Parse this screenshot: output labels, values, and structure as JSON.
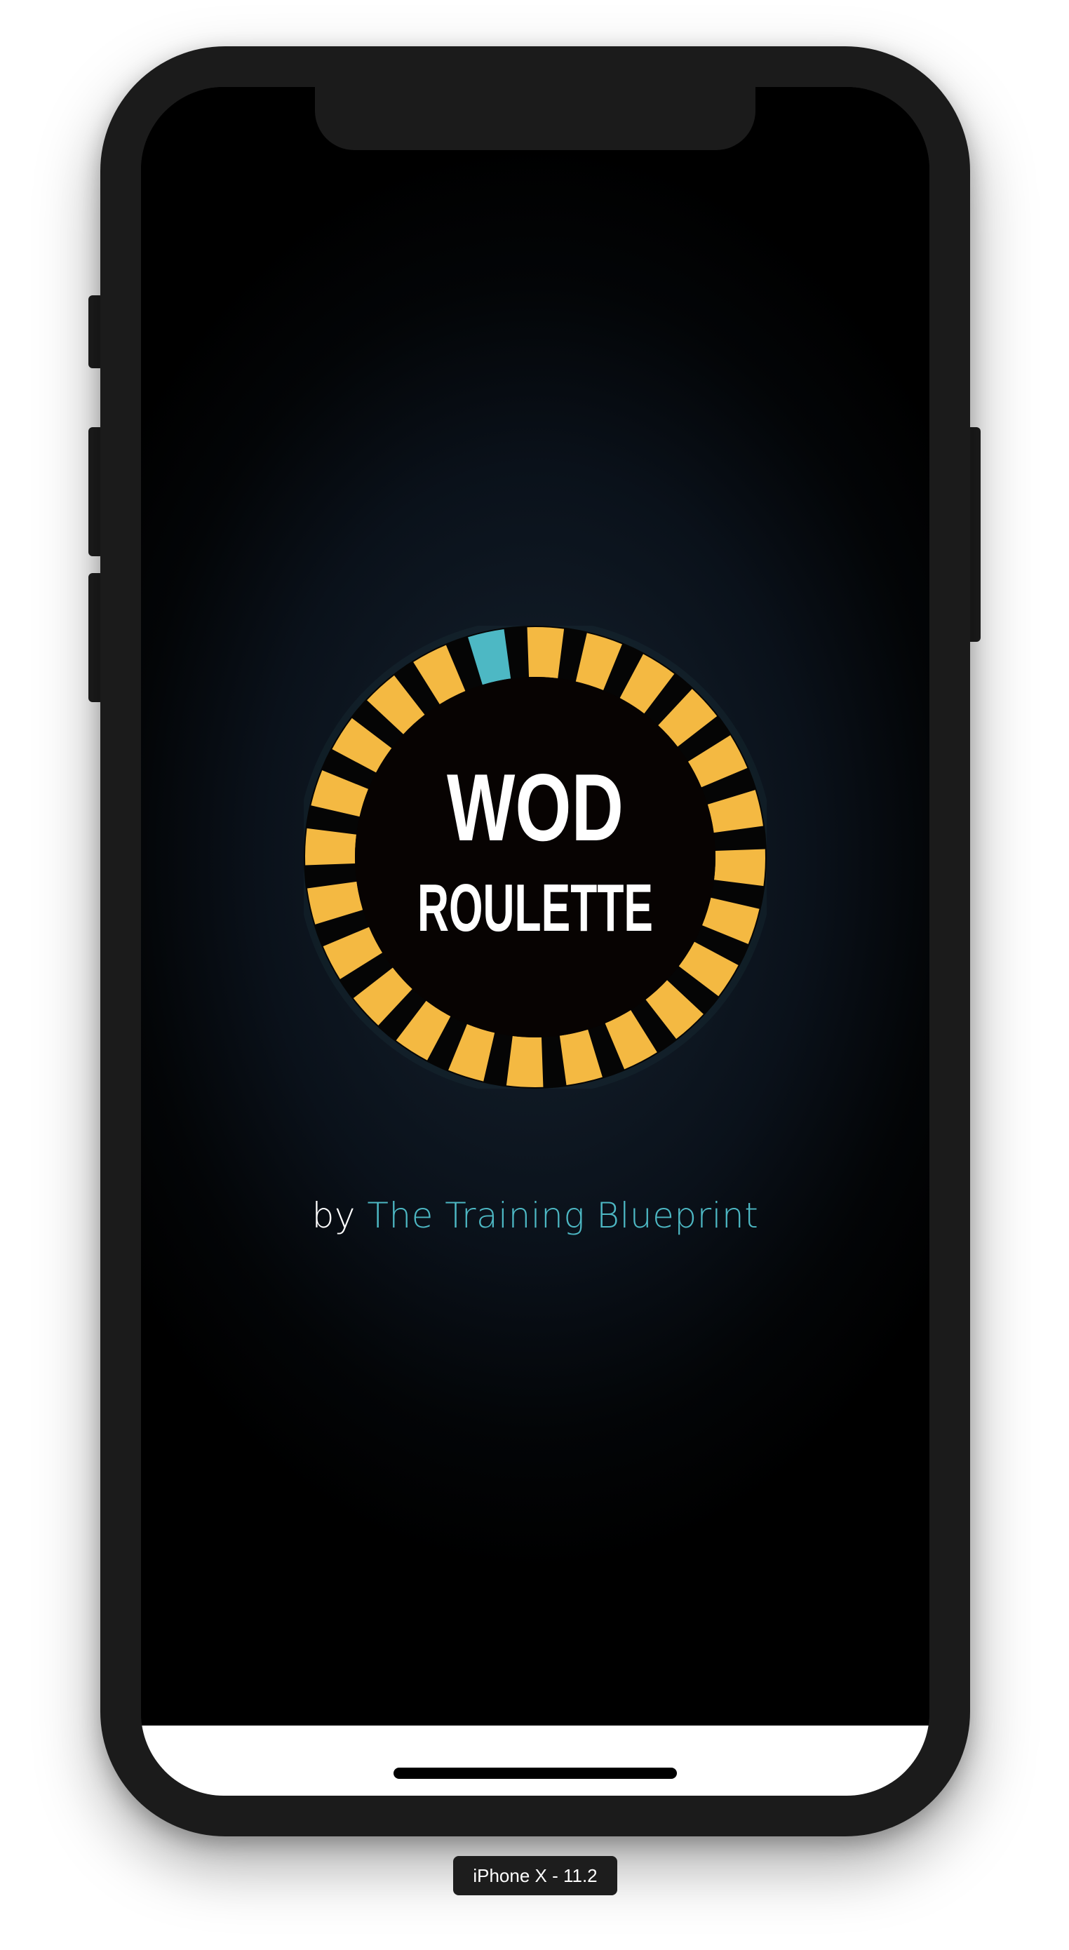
{
  "device": {
    "label": "iPhone X - 11.2"
  },
  "app": {
    "logo": {
      "line1": "WOD",
      "line2": "ROULETTE",
      "segment_count": 24,
      "highlight_segment": "top-left",
      "colors": {
        "segment": "#f4b942",
        "highlight": "#4db8c4",
        "ring": "#050505",
        "center": "#070302",
        "text": "#ffffff"
      }
    },
    "byline": {
      "prefix": "by",
      "link": "The Training Blueprint"
    }
  }
}
